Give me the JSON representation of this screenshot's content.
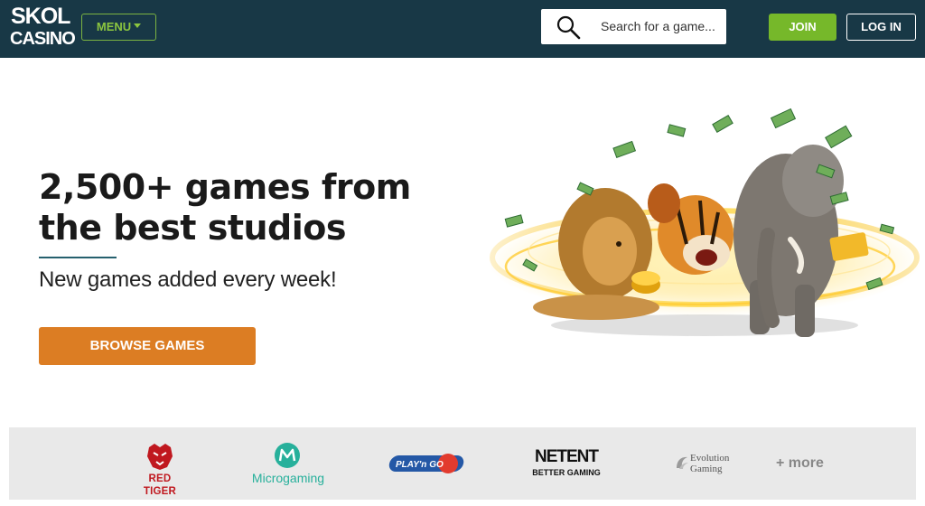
{
  "header": {
    "logo_line1": "SKOL",
    "logo_line2": "CASINO",
    "menu_label": "MENU",
    "search_placeholder": "Search for a game...",
    "join_label": "JOIN",
    "login_label": "LOG IN"
  },
  "hero": {
    "headline_line1": "2,500+ games from",
    "headline_line2": "the best studios",
    "subheadline": "New games added every week!",
    "cta_label": "BROWSE GAMES"
  },
  "studios": {
    "red_tiger": "RED TIGER",
    "microgaming": "Microgaming",
    "playngo": "PLAY'n GO",
    "netent": "NETENT",
    "netent_tagline": "BETTER GAMING",
    "evolution_line1": "Evolution",
    "evolution_line2": "Gaming",
    "more_label": "+ more"
  },
  "colors": {
    "header_bg": "#183846",
    "accent_green": "#76b82a",
    "cta_orange": "#dc7d23",
    "strip_bg": "#e9e9e9"
  }
}
